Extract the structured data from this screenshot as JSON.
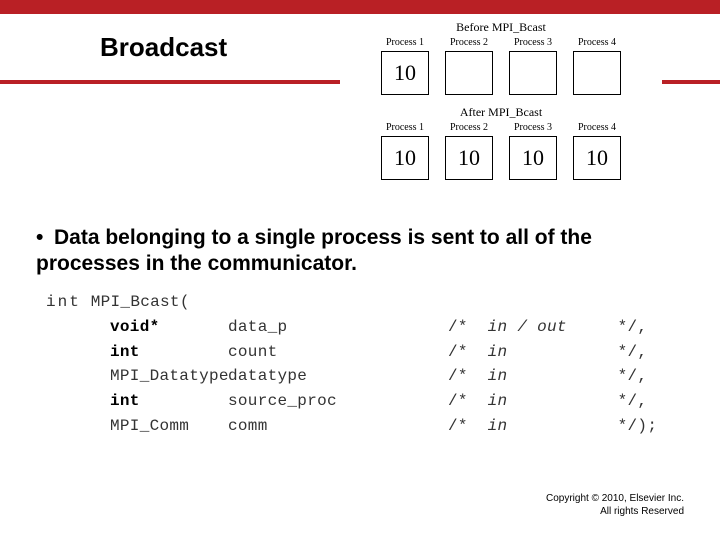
{
  "header": {
    "title": "Broadcast"
  },
  "diagram": {
    "before_title": "Before MPI_Bcast",
    "after_title": "After MPI_Bcast",
    "labels": [
      "Process 1",
      "Process 2",
      "Process 3",
      "Process 4"
    ],
    "before_values": [
      "10",
      "",
      "",
      ""
    ],
    "after_values": [
      "10",
      "10",
      "10",
      "10"
    ]
  },
  "bullet": {
    "text": "Data belonging to a single process is sent to all of the processes in the communicator."
  },
  "code": {
    "decl_kw": "int",
    "decl_fn": "MPI_Bcast(",
    "params": [
      {
        "type": "void*",
        "name": "data_p",
        "comment": "in / out",
        "end": "*/,"
      },
      {
        "type": "int",
        "name": "count",
        "comment": "in",
        "end": "*/,"
      },
      {
        "type": "MPI_Datatype",
        "name": "datatype",
        "comment": "in",
        "end": "*/,"
      },
      {
        "type": "int",
        "name": "source_proc",
        "comment": "in",
        "end": "*/,"
      },
      {
        "type": "MPI_Comm",
        "name": "comm",
        "comment": "in",
        "end": "*/);"
      }
    ]
  },
  "footer": {
    "line1": "Copyright © 2010, Elsevier Inc.",
    "line2": "All rights Reserved"
  }
}
